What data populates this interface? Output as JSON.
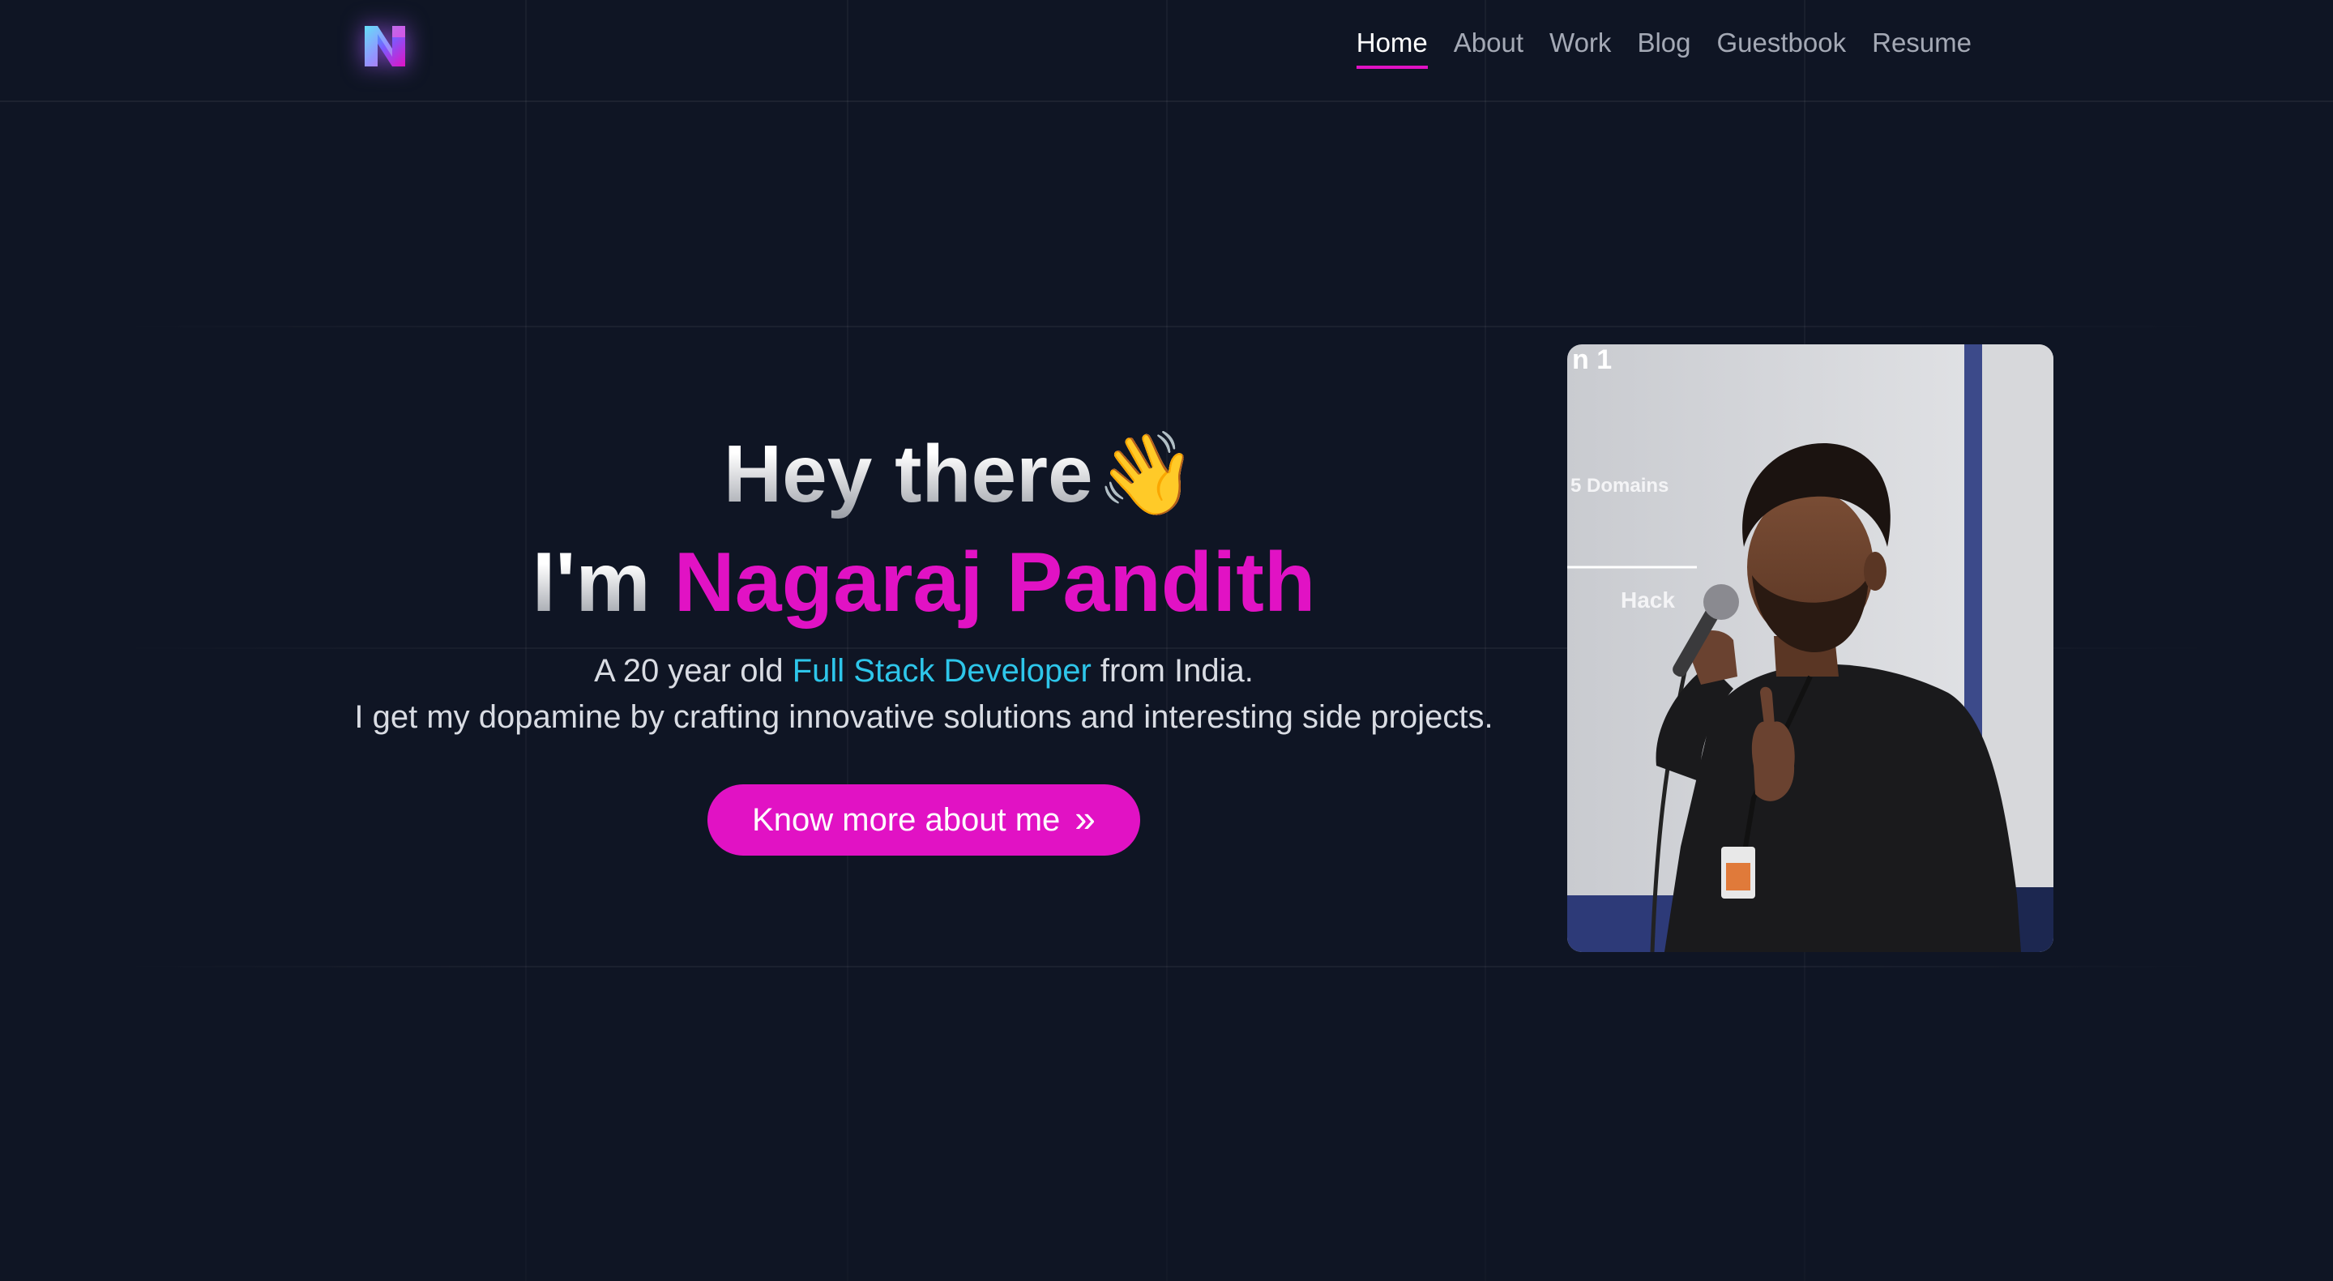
{
  "header": {
    "logo_name": "NP monogram logo",
    "nav": [
      {
        "label": "Home",
        "active": true
      },
      {
        "label": "About",
        "active": false
      },
      {
        "label": "Work",
        "active": false
      },
      {
        "label": "Blog",
        "active": false
      },
      {
        "label": "Guestbook",
        "active": false
      },
      {
        "label": "Resume",
        "active": false
      }
    ]
  },
  "hero": {
    "greeting": "Hey there",
    "greeting_emoji": "👋",
    "intro_prefix": "I'm",
    "name": "Nagaraj Pandith",
    "bio_line1_before": "A 20 year old",
    "bio_line1_highlight": "Full Stack Developer",
    "bio_line1_after": "from India.",
    "bio_line2": "I get my dopamine by crafting innovative solutions and interesting side projects.",
    "cta_label": "Know more about me",
    "cta_icon": "double-chevron-right-icon"
  },
  "portrait": {
    "slide_text_top": "n 1",
    "slide_text_domains": "5 Domains",
    "slide_text_hack": "Hack"
  },
  "colors": {
    "background": "#0f1524",
    "accent": "#e112c4",
    "highlight": "#2ec6ea",
    "nav_inactive": "#a4a9b5"
  }
}
